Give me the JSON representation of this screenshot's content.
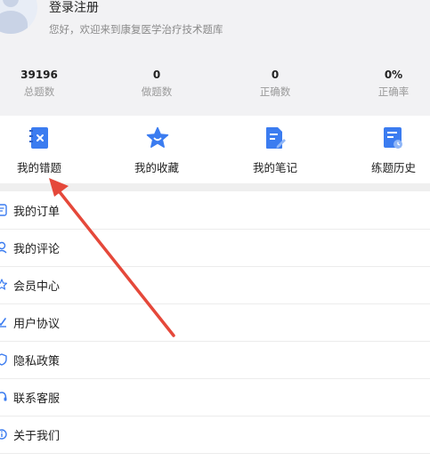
{
  "profile": {
    "login_label": "登录注册",
    "welcome_text": "您好，欢迎来到康复医学治疗技术题库"
  },
  "stats": [
    {
      "value": "39196",
      "label": "总题数"
    },
    {
      "value": "0",
      "label": "做题数"
    },
    {
      "value": "0",
      "label": "正确数"
    },
    {
      "value": "0%",
      "label": "正确率"
    }
  ],
  "features": [
    {
      "label": "我的错题",
      "icon": "error-book-icon"
    },
    {
      "label": "我的收藏",
      "icon": "star-icon"
    },
    {
      "label": "我的笔记",
      "icon": "note-icon"
    },
    {
      "label": "练题历史",
      "icon": "history-icon"
    }
  ],
  "menu": [
    {
      "label": "我的订单",
      "icon": "order-icon"
    },
    {
      "label": "我的评论",
      "icon": "comment-icon"
    },
    {
      "label": "会员中心",
      "icon": "member-icon"
    },
    {
      "label": "用户协议",
      "icon": "agreement-icon"
    },
    {
      "label": "隐私政策",
      "icon": "privacy-icon"
    },
    {
      "label": "联系客服",
      "icon": "service-icon"
    },
    {
      "label": "关于我们",
      "icon": "about-icon"
    }
  ],
  "colors": {
    "accent": "#3b7cf0",
    "annotation_arrow": "#e5483a",
    "header_bg": "#f2f2f4"
  }
}
